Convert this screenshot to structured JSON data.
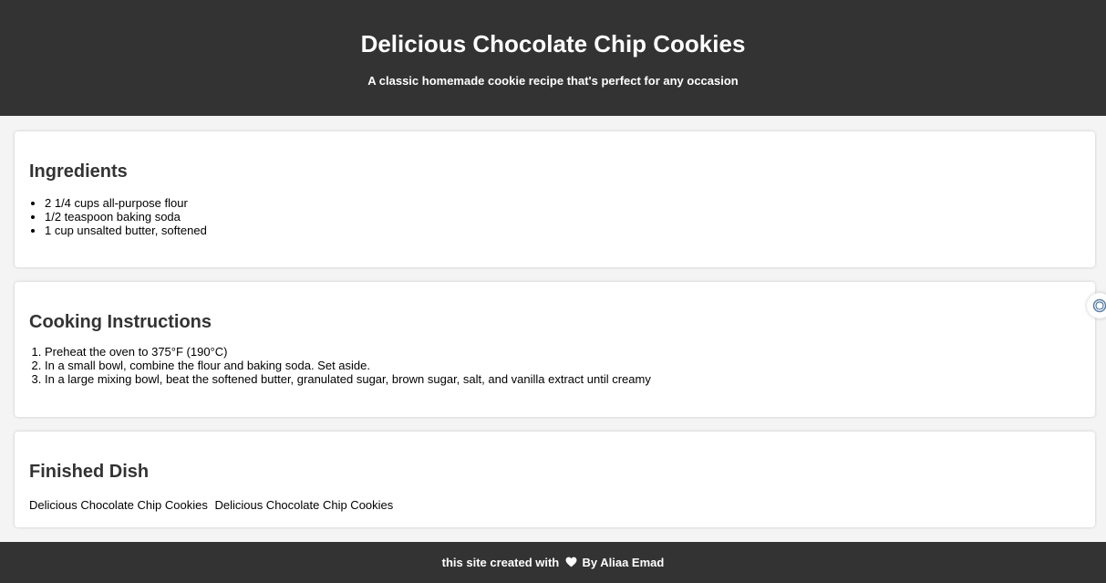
{
  "header": {
    "title": "Delicious Chocolate Chip Cookies",
    "subtitle": "A classic homemade cookie recipe that's perfect for any occasion"
  },
  "ingredients": {
    "heading": "Ingredients",
    "items": [
      "2 1/4 cups all-purpose flour",
      "1/2 teaspoon baking soda",
      "1 cup unsalted butter, softened"
    ]
  },
  "instructions": {
    "heading": "Cooking Instructions",
    "steps": [
      "Preheat the oven to 375°F (190°C)",
      "In a small bowl, combine the flour and baking soda. Set aside.",
      "In a large mixing bowl, beat the softened butter, granulated sugar, brown sugar, salt, and vanilla extract until creamy"
    ]
  },
  "finished_dish": {
    "heading": "Finished Dish",
    "images": [
      {
        "alt": "Delicious Chocolate Chip Cookies"
      },
      {
        "alt": "Delicious Chocolate Chip Cookies"
      }
    ]
  },
  "footer": {
    "text_before": "this site created with",
    "text_after": "By Aliaa Emad"
  },
  "icons": {
    "heart": "heart-icon",
    "widget": "assistant-widget-icon"
  },
  "colors": {
    "header_bg": "#333333",
    "page_bg": "#f4f4f4",
    "card_bg": "#ffffff"
  }
}
